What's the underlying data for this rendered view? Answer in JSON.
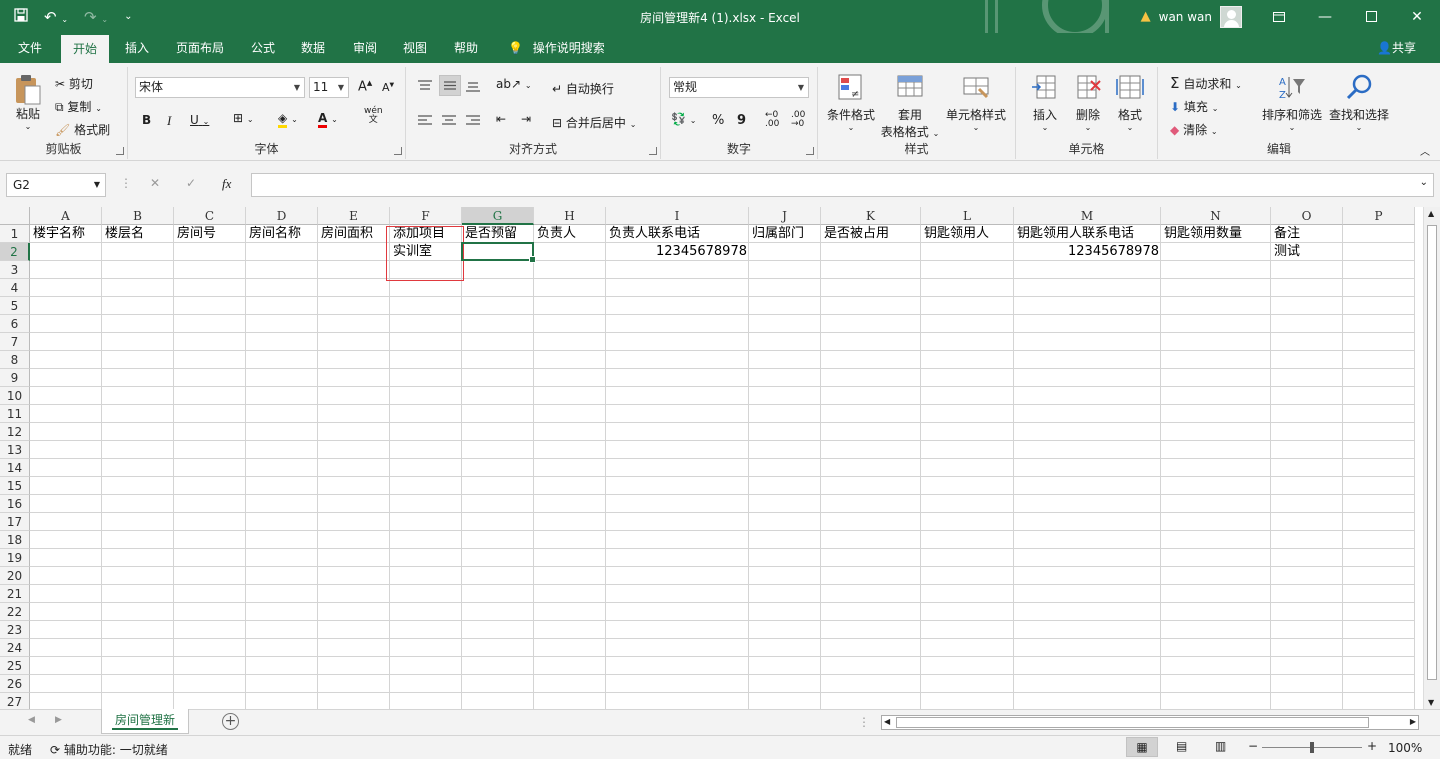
{
  "window": {
    "title": "房间管理新4 (1).xlsx  -  Excel",
    "user": "wan wan"
  },
  "menu": {
    "tabs": [
      "文件",
      "开始",
      "插入",
      "页面布局",
      "公式",
      "数据",
      "审阅",
      "视图",
      "帮助"
    ],
    "active": "开始",
    "tell_me": "操作说明搜索",
    "share": "共享"
  },
  "ribbon": {
    "clipboard": {
      "paste": "粘贴",
      "cut": "剪切",
      "copy": "复制",
      "format_painter": "格式刷",
      "label": "剪贴板"
    },
    "font": {
      "name": "宋体",
      "size": "11",
      "label": "字体",
      "bold": "B",
      "italic": "I",
      "underline": "U",
      "phonetic_top": "wén",
      "phonetic_bottom": "文"
    },
    "alignment": {
      "wrap": "自动换行",
      "merge": "合并后居中",
      "label": "对齐方式"
    },
    "number": {
      "format": "常规",
      "label": "数字",
      "percent": "%",
      "comma": "9"
    },
    "styles": {
      "conditional": "条件格式",
      "table_line1": "套用",
      "table_line2": "表格格式",
      "cell_styles": "单元格样式",
      "label": "样式"
    },
    "cells": {
      "insert": "插入",
      "delete": "删除",
      "format": "格式",
      "label": "单元格"
    },
    "editing": {
      "autosum": "自动求和",
      "fill": "填充",
      "clear": "清除",
      "sort": "排序和筛选",
      "find": "查找和选择",
      "label": "编辑"
    }
  },
  "formula_bar": {
    "name_box": "G2",
    "fx": "fx",
    "value": ""
  },
  "sheet": {
    "columns": [
      "A",
      "B",
      "C",
      "D",
      "E",
      "F",
      "G",
      "H",
      "I",
      "J",
      "K",
      "L",
      "M",
      "N",
      "O",
      "P"
    ],
    "selected_column": "G",
    "selected_row": 2,
    "rows": [
      "1",
      "2",
      "3",
      "4",
      "5",
      "6",
      "7",
      "8",
      "9",
      "10",
      "11",
      "12",
      "13",
      "14",
      "15",
      "16",
      "17",
      "18",
      "19",
      "20",
      "21",
      "22",
      "23",
      "24",
      "25",
      "26",
      "27"
    ],
    "header_row": [
      "楼宇名称",
      "楼层名",
      "房间号",
      "房间名称",
      "房间面积",
      "添加项目",
      "是否预留",
      "负责人",
      "负责人联系电话",
      "归属部门",
      "是否被占用",
      "钥匙领用人",
      "钥匙领用人联系电话",
      "钥匙领用数量",
      "备注",
      ""
    ],
    "row2": [
      "",
      "",
      "",
      "",
      "",
      "实训室",
      "",
      "",
      "12345678978",
      "",
      "",
      "",
      "12345678978",
      "",
      "测试",
      ""
    ]
  },
  "tabs": {
    "sheet_name": "房间管理新"
  },
  "status": {
    "ready": "就绪",
    "accessibility": "辅助功能: 一切就绪",
    "zoom": "100%"
  }
}
